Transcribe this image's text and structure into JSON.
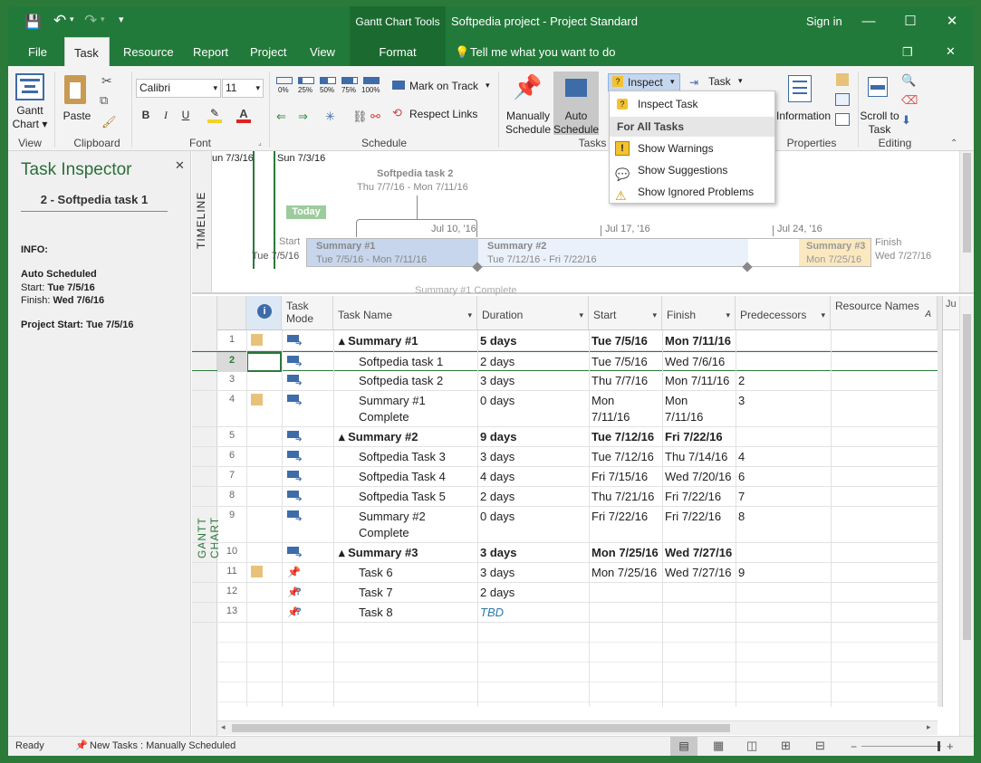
{
  "window": {
    "title": "Softpedia project - Project Standard",
    "context_tab": "Gantt Chart Tools",
    "sign_in": "Sign in",
    "min": "—",
    "max": "☐",
    "close": "✕",
    "restore": "❐",
    "ribbon_close": "✕"
  },
  "qat": {
    "save": "💾",
    "undo": "↶",
    "redo": "↷",
    "customize": "▾"
  },
  "tabs": [
    {
      "label": "File"
    },
    {
      "label": "Task"
    },
    {
      "label": "Resource"
    },
    {
      "label": "Report"
    },
    {
      "label": "Project"
    },
    {
      "label": "View"
    },
    {
      "label": "Format"
    }
  ],
  "tell_me": "Tell me what you want to do",
  "ribbon": {
    "groups": {
      "view": "View",
      "clipboard": "Clipboard",
      "font": "Font",
      "schedule": "Schedule",
      "tasks": "Tasks",
      "properties": "Properties",
      "editing": "Editing"
    },
    "gantt_chart": "Gantt Chart ▾",
    "paste": "Paste",
    "font_name": "Calibri",
    "font_size": "11",
    "pct": [
      "0%",
      "25%",
      "50%",
      "75%",
      "100%"
    ],
    "mark_on_track": "Mark on Track",
    "respect_links": "Respect Links",
    "manually": "Manually Schedule",
    "auto": "Auto Schedule",
    "inspect": "Inspect",
    "task": "Task",
    "information": "Information",
    "scroll": "Scroll to Task",
    "bold": "B",
    "italic": "I",
    "underline": "U"
  },
  "dropdown": {
    "inspect_task": "Inspect Task",
    "header": "For All Tasks",
    "show_warnings": "Show Warnings",
    "show_suggestions": "Show Suggestions",
    "show_ignored": "Show Ignored Problems"
  },
  "inspector": {
    "title": "Task Inspector",
    "close": "✕",
    "task": "2 - Softpedia task 1",
    "info": "INFO:",
    "auto": "Auto Scheduled",
    "start_label": "Start:",
    "start": "Tue 7/5/16",
    "finish_label": "Finish:",
    "finish": "Wed 7/6/16",
    "proj_label": "Project Start:",
    "proj": "Tue 7/5/16"
  },
  "timeline": {
    "label": "TIMELINE",
    "left_date": "un 7/3/16",
    "sun": "Sun 7/3/16",
    "callout_title": "Softpedia task 2",
    "callout_dates": "Thu 7/7/16 - Mon 7/11/16",
    "today": "Today",
    "jul10": "Jul 10, '16",
    "jul17": "Jul 17, '16",
    "jul24": "Jul 24, '16",
    "start_label": "Start",
    "start_date": "Tue 7/5/16",
    "finish_label": "Finish",
    "finish_date": "Wed 7/27/16",
    "s1": "Summary #1",
    "s1d": "Tue 7/5/16 - Mon 7/11/16",
    "s2": "Summary #2",
    "s2d": "Tue 7/12/16 - Fri 7/22/16",
    "s3": "Summary #3",
    "s3d": "Mon 7/25/16",
    "milestone": "Summary #1 Complete"
  },
  "grid": {
    "label": "GANTT CHART",
    "headers": {
      "info": "i",
      "mode": "Task Mode",
      "name": "Task Name",
      "duration": "Duration",
      "start": "Start",
      "finish": "Finish",
      "pred": "Predecessors",
      "res": "Resource Names",
      "add": "A",
      "ju": "Ju"
    },
    "rows": [
      {
        "n": "1",
        "note": true,
        "mode": "auto",
        "name": "▴ Summary #1",
        "duration": "5 days",
        "start": "Tue 7/5/16",
        "finish": "Mon 7/11/16",
        "pred": "",
        "bold": true,
        "indent": 0,
        "h": 22
      },
      {
        "n": "2",
        "note": false,
        "mode": "auto",
        "name": "Softpedia task 1",
        "duration": "2 days",
        "start": "Tue 7/5/16",
        "finish": "Wed 7/6/16",
        "pred": "",
        "bold": false,
        "indent": 1,
        "h": 22,
        "sel": true
      },
      {
        "n": "3",
        "note": false,
        "mode": "auto",
        "name": "Softpedia task 2",
        "duration": "3 days",
        "start": "Thu 7/7/16",
        "finish": "Mon 7/11/16",
        "pred": "2",
        "bold": false,
        "indent": 1,
        "h": 22
      },
      {
        "n": "4",
        "note": true,
        "mode": "auto",
        "name": "Summary #1",
        "name2": "Complete",
        "duration": "0 days",
        "start": "Mon",
        "start2": "7/11/16",
        "finish": "Mon",
        "finish2": "7/11/16",
        "pred": "3",
        "bold": false,
        "indent": 1,
        "h": 40
      },
      {
        "n": "5",
        "note": false,
        "mode": "auto",
        "name": "▴ Summary #2",
        "duration": "9 days",
        "start": "Tue 7/12/16",
        "finish": "Fri 7/22/16",
        "pred": "",
        "bold": true,
        "indent": 0,
        "h": 22
      },
      {
        "n": "6",
        "note": false,
        "mode": "auto",
        "name": "Softpedia Task 3",
        "duration": "3 days",
        "start": "Tue 7/12/16",
        "finish": "Thu 7/14/16",
        "pred": "4",
        "bold": false,
        "indent": 1,
        "h": 22
      },
      {
        "n": "7",
        "note": false,
        "mode": "auto",
        "name": "Softpedia Task 4",
        "duration": "4 days",
        "start": "Fri 7/15/16",
        "finish": "Wed 7/20/16",
        "pred": "6",
        "bold": false,
        "indent": 1,
        "h": 22
      },
      {
        "n": "8",
        "note": false,
        "mode": "auto",
        "name": "Softpedia Task 5",
        "duration": "2 days",
        "start": "Thu 7/21/16",
        "finish": "Fri 7/22/16",
        "pred": "7",
        "bold": false,
        "indent": 1,
        "h": 22
      },
      {
        "n": "9",
        "note": false,
        "mode": "auto",
        "name": "Summary #2",
        "name2": "Complete",
        "duration": "0 days",
        "start": "Fri 7/22/16",
        "finish": "Fri 7/22/16",
        "pred": "8",
        "bold": false,
        "indent": 1,
        "h": 40
      },
      {
        "n": "10",
        "note": false,
        "mode": "auto",
        "name": "▴ Summary #3",
        "duration": "3 days",
        "start": "Mon 7/25/16",
        "finish": "Wed 7/27/16",
        "pred": "",
        "bold": true,
        "indent": 0,
        "h": 22
      },
      {
        "n": "11",
        "note": true,
        "mode": "pin",
        "name": "Task 6",
        "duration": "3 days",
        "start": "Mon 7/25/16",
        "finish": "Wed 7/27/16",
        "pred": "9",
        "bold": false,
        "indent": 1,
        "h": 22
      },
      {
        "n": "12",
        "note": false,
        "mode": "pinq",
        "name": "Task 7",
        "duration": "2 days",
        "start": "",
        "finish": "",
        "pred": "",
        "bold": false,
        "indent": 1,
        "h": 22
      },
      {
        "n": "13",
        "note": false,
        "mode": "pinq",
        "name": "Task 8",
        "duration": "TBD",
        "start": "",
        "finish": "",
        "pred": "",
        "bold": false,
        "indent": 1,
        "h": 22,
        "tbd": true
      }
    ]
  },
  "status": {
    "ready": "Ready",
    "new_tasks": "New Tasks : Manually Scheduled"
  },
  "colors": {
    "green": "#227a3a",
    "dark_green": "#1b6b30",
    "task_blue": "#3d6ca8",
    "note": "#e8c27a"
  }
}
